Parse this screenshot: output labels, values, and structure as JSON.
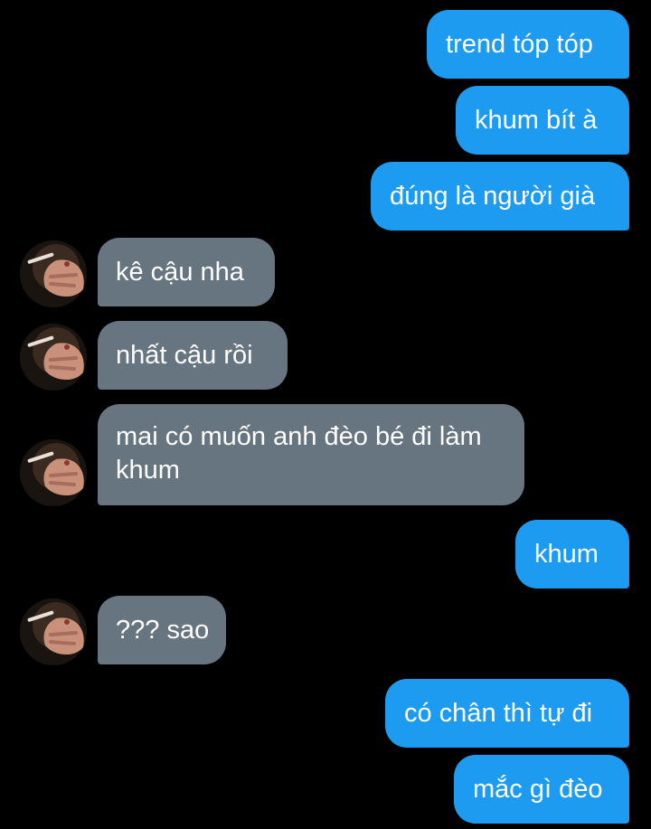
{
  "messages": [
    {
      "side": "sent",
      "text": "trend tóp tóp"
    },
    {
      "side": "sent",
      "text": "khum bít à"
    },
    {
      "side": "sent",
      "text": "đúng là người già"
    },
    {
      "side": "recv",
      "text": "kê cậu nha"
    },
    {
      "side": "recv",
      "text": "nhất cậu rồi"
    },
    {
      "side": "recv",
      "text": "mai có muốn anh đèo bé đi làm khum"
    },
    {
      "side": "sent",
      "text": "khum"
    },
    {
      "side": "recv",
      "text": "??? sao"
    },
    {
      "side": "sent",
      "text": "có chân thì tự đi"
    },
    {
      "side": "sent",
      "text": "mắc gì đèo"
    }
  ],
  "colors": {
    "background": "#000000",
    "sent_bubble": "#1d9bf0",
    "received_bubble": "#66757f",
    "text": "#ffffff"
  },
  "icons": {
    "avatar": "avatar-photo-hand-icon"
  }
}
